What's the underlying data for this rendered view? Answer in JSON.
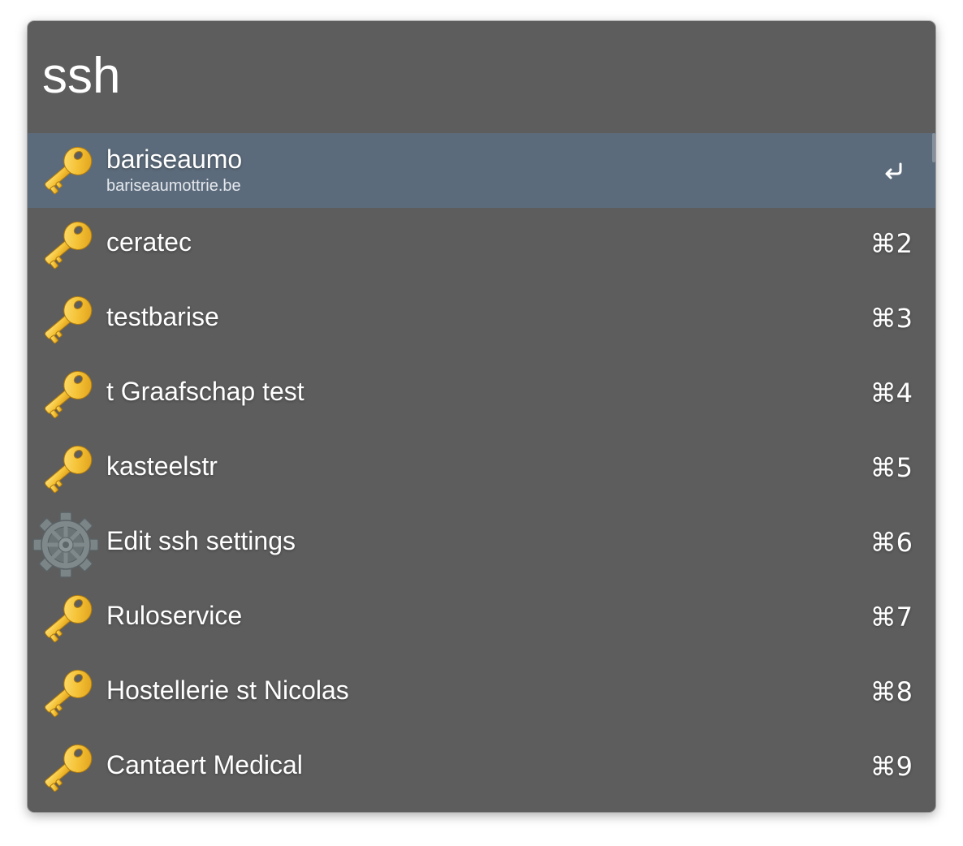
{
  "search": {
    "query": "ssh"
  },
  "results": [
    {
      "title": "bariseaumo",
      "subtitle": "bariseaumottrie.be",
      "shortcut": "",
      "icon": "key-icon",
      "selected": true
    },
    {
      "title": "ceratec",
      "subtitle": "",
      "shortcut": "⌘2",
      "icon": "key-icon"
    },
    {
      "title": "testbarise",
      "subtitle": "",
      "shortcut": "⌘3",
      "icon": "key-icon"
    },
    {
      "title": "t Graafschap test",
      "subtitle": "",
      "shortcut": "⌘4",
      "icon": "key-icon"
    },
    {
      "title": "kasteelstr",
      "subtitle": "",
      "shortcut": "⌘5",
      "icon": "key-icon"
    },
    {
      "title": "Edit ssh settings",
      "subtitle": "",
      "shortcut": "⌘6",
      "icon": "gear-icon"
    },
    {
      "title": "Ruloservice",
      "subtitle": "",
      "shortcut": "⌘7",
      "icon": "key-icon"
    },
    {
      "title": "Hostellerie st Nicolas",
      "subtitle": "",
      "shortcut": "⌘8",
      "icon": "key-icon"
    },
    {
      "title": "Cantaert Medical",
      "subtitle": "",
      "shortcut": "⌘9",
      "icon": "key-icon"
    }
  ],
  "selected_action_icon": "return-icon",
  "colors": {
    "window_bg": "#5d5d5d",
    "selected_row_bg": "#5c6b7b",
    "text": "#ffffff",
    "key_gold": "#f2bb2f"
  }
}
